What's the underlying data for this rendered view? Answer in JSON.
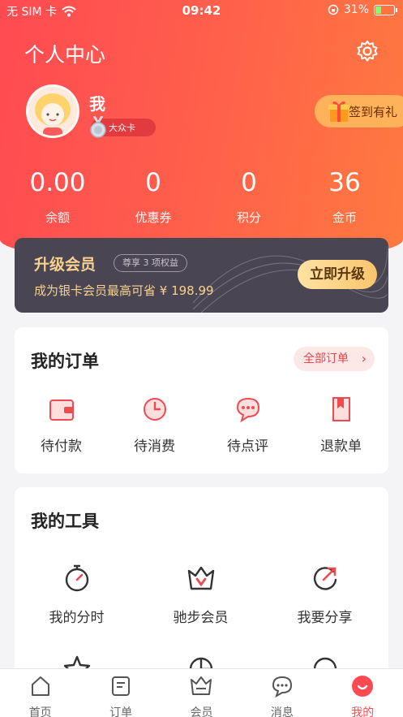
{
  "status_bar": {
    "carrier": "无 SIM 卡",
    "time": "09:42",
    "battery": "31%"
  },
  "header": {
    "title": "个人中心"
  },
  "profile": {
    "name": "我",
    "level": "大众卡",
    "signin_label": "签到有礼"
  },
  "stats": [
    {
      "value": "0.00",
      "label": "余额"
    },
    {
      "value": "0",
      "label": "优惠券"
    },
    {
      "value": "0",
      "label": "积分"
    },
    {
      "value": "36",
      "label": "金币"
    }
  ],
  "vip": {
    "title": "升级会员",
    "tag": "尊享 3 项权益",
    "desc": "成为银卡会员最高可省 ¥ 198.99",
    "button": "立即升级"
  },
  "orders": {
    "title": "我的订单",
    "all_label": "全部订单",
    "items": [
      {
        "label": "待付款",
        "icon": "wallet-icon"
      },
      {
        "label": "待消费",
        "icon": "clock-icon"
      },
      {
        "label": "待点评",
        "icon": "chat-bubble-icon"
      },
      {
        "label": "退款单",
        "icon": "refund-doc-icon"
      }
    ]
  },
  "tools": {
    "title": "我的工具",
    "items": [
      {
        "label": "我的分时",
        "icon": "stopwatch-icon"
      },
      {
        "label": "驰步会员",
        "icon": "crown-icon"
      },
      {
        "label": "我要分享",
        "icon": "share-icon"
      }
    ]
  },
  "tabbar": [
    {
      "label": "首页",
      "icon": "home-icon"
    },
    {
      "label": "订单",
      "icon": "order-icon"
    },
    {
      "label": "会员",
      "icon": "crown-icon"
    },
    {
      "label": "消息",
      "icon": "message-icon"
    },
    {
      "label": "我的",
      "icon": "profile-icon",
      "active": true
    }
  ],
  "colors": {
    "accent": "#ff4a52",
    "accent_orange": "#ff7a3f",
    "vip_bg": "#4a4552",
    "vip_gold": "#f6d18f"
  }
}
